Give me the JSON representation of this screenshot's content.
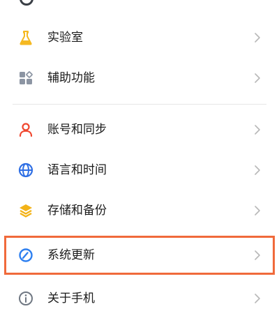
{
  "menu": {
    "items": [
      {
        "label": "实验室",
        "icon": "flask-icon",
        "color": "#f5b921"
      },
      {
        "label": "辅助功能",
        "icon": "grid-apps-icon",
        "color": "#8c95a3"
      },
      {
        "label": "账号和同步",
        "icon": "user-icon",
        "color": "#f0472f"
      },
      {
        "label": "语言和时间",
        "icon": "globe-icon",
        "color": "#2f6fe4"
      },
      {
        "label": "存储和备份",
        "icon": "layers-icon",
        "color": "#f3b318"
      },
      {
        "label": "系统更新",
        "icon": "refresh-icon",
        "color": "#2d7ff0"
      },
      {
        "label": "关于手机",
        "icon": "info-icon",
        "color": "#6f7782"
      }
    ],
    "chevron_icon": "chevron-right-icon",
    "highlight_color": "#f06a3b"
  }
}
